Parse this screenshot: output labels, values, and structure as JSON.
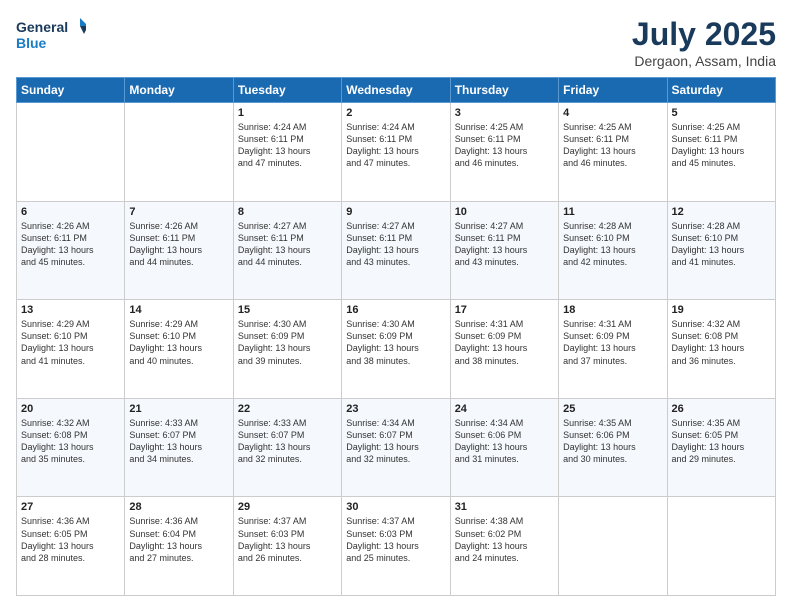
{
  "header": {
    "logo_line1": "General",
    "logo_line2": "Blue",
    "month_title": "July 2025",
    "location": "Dergaon, Assam, India"
  },
  "days_of_week": [
    "Sunday",
    "Monday",
    "Tuesday",
    "Wednesday",
    "Thursday",
    "Friday",
    "Saturday"
  ],
  "weeks": [
    [
      {
        "day": "",
        "text": ""
      },
      {
        "day": "",
        "text": ""
      },
      {
        "day": "1",
        "text": "Sunrise: 4:24 AM\nSunset: 6:11 PM\nDaylight: 13 hours\nand 47 minutes."
      },
      {
        "day": "2",
        "text": "Sunrise: 4:24 AM\nSunset: 6:11 PM\nDaylight: 13 hours\nand 47 minutes."
      },
      {
        "day": "3",
        "text": "Sunrise: 4:25 AM\nSunset: 6:11 PM\nDaylight: 13 hours\nand 46 minutes."
      },
      {
        "day": "4",
        "text": "Sunrise: 4:25 AM\nSunset: 6:11 PM\nDaylight: 13 hours\nand 46 minutes."
      },
      {
        "day": "5",
        "text": "Sunrise: 4:25 AM\nSunset: 6:11 PM\nDaylight: 13 hours\nand 45 minutes."
      }
    ],
    [
      {
        "day": "6",
        "text": "Sunrise: 4:26 AM\nSunset: 6:11 PM\nDaylight: 13 hours\nand 45 minutes."
      },
      {
        "day": "7",
        "text": "Sunrise: 4:26 AM\nSunset: 6:11 PM\nDaylight: 13 hours\nand 44 minutes."
      },
      {
        "day": "8",
        "text": "Sunrise: 4:27 AM\nSunset: 6:11 PM\nDaylight: 13 hours\nand 44 minutes."
      },
      {
        "day": "9",
        "text": "Sunrise: 4:27 AM\nSunset: 6:11 PM\nDaylight: 13 hours\nand 43 minutes."
      },
      {
        "day": "10",
        "text": "Sunrise: 4:27 AM\nSunset: 6:11 PM\nDaylight: 13 hours\nand 43 minutes."
      },
      {
        "day": "11",
        "text": "Sunrise: 4:28 AM\nSunset: 6:10 PM\nDaylight: 13 hours\nand 42 minutes."
      },
      {
        "day": "12",
        "text": "Sunrise: 4:28 AM\nSunset: 6:10 PM\nDaylight: 13 hours\nand 41 minutes."
      }
    ],
    [
      {
        "day": "13",
        "text": "Sunrise: 4:29 AM\nSunset: 6:10 PM\nDaylight: 13 hours\nand 41 minutes."
      },
      {
        "day": "14",
        "text": "Sunrise: 4:29 AM\nSunset: 6:10 PM\nDaylight: 13 hours\nand 40 minutes."
      },
      {
        "day": "15",
        "text": "Sunrise: 4:30 AM\nSunset: 6:09 PM\nDaylight: 13 hours\nand 39 minutes."
      },
      {
        "day": "16",
        "text": "Sunrise: 4:30 AM\nSunset: 6:09 PM\nDaylight: 13 hours\nand 38 minutes."
      },
      {
        "day": "17",
        "text": "Sunrise: 4:31 AM\nSunset: 6:09 PM\nDaylight: 13 hours\nand 38 minutes."
      },
      {
        "day": "18",
        "text": "Sunrise: 4:31 AM\nSunset: 6:09 PM\nDaylight: 13 hours\nand 37 minutes."
      },
      {
        "day": "19",
        "text": "Sunrise: 4:32 AM\nSunset: 6:08 PM\nDaylight: 13 hours\nand 36 minutes."
      }
    ],
    [
      {
        "day": "20",
        "text": "Sunrise: 4:32 AM\nSunset: 6:08 PM\nDaylight: 13 hours\nand 35 minutes."
      },
      {
        "day": "21",
        "text": "Sunrise: 4:33 AM\nSunset: 6:07 PM\nDaylight: 13 hours\nand 34 minutes."
      },
      {
        "day": "22",
        "text": "Sunrise: 4:33 AM\nSunset: 6:07 PM\nDaylight: 13 hours\nand 32 minutes."
      },
      {
        "day": "23",
        "text": "Sunrise: 4:34 AM\nSunset: 6:07 PM\nDaylight: 13 hours\nand 32 minutes."
      },
      {
        "day": "24",
        "text": "Sunrise: 4:34 AM\nSunset: 6:06 PM\nDaylight: 13 hours\nand 31 minutes."
      },
      {
        "day": "25",
        "text": "Sunrise: 4:35 AM\nSunset: 6:06 PM\nDaylight: 13 hours\nand 30 minutes."
      },
      {
        "day": "26",
        "text": "Sunrise: 4:35 AM\nSunset: 6:05 PM\nDaylight: 13 hours\nand 29 minutes."
      }
    ],
    [
      {
        "day": "27",
        "text": "Sunrise: 4:36 AM\nSunset: 6:05 PM\nDaylight: 13 hours\nand 28 minutes."
      },
      {
        "day": "28",
        "text": "Sunrise: 4:36 AM\nSunset: 6:04 PM\nDaylight: 13 hours\nand 27 minutes."
      },
      {
        "day": "29",
        "text": "Sunrise: 4:37 AM\nSunset: 6:03 PM\nDaylight: 13 hours\nand 26 minutes."
      },
      {
        "day": "30",
        "text": "Sunrise: 4:37 AM\nSunset: 6:03 PM\nDaylight: 13 hours\nand 25 minutes."
      },
      {
        "day": "31",
        "text": "Sunrise: 4:38 AM\nSunset: 6:02 PM\nDaylight: 13 hours\nand 24 minutes."
      },
      {
        "day": "",
        "text": ""
      },
      {
        "day": "",
        "text": ""
      }
    ]
  ]
}
